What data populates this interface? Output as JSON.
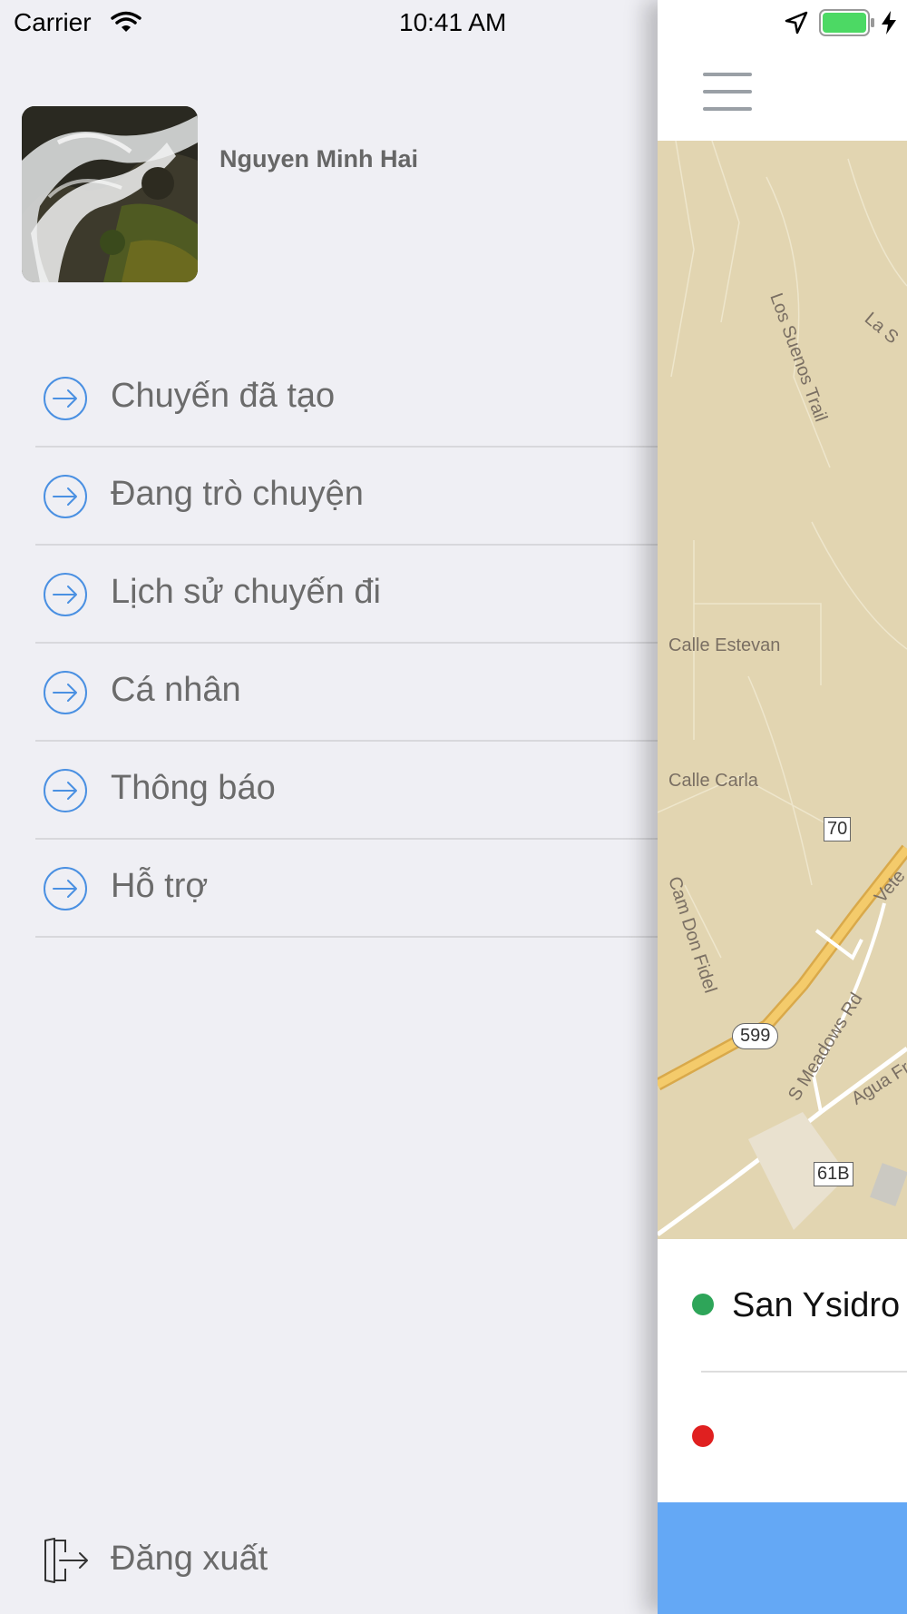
{
  "status_bar": {
    "carrier": "Carrier",
    "time": "10:41 AM"
  },
  "profile": {
    "name": "Nguyen Minh Hai",
    "avatar": "waterfall-photo"
  },
  "menu": {
    "items": [
      {
        "label": "Chuyến đã tạo",
        "icon": "arrow-circle-right-icon"
      },
      {
        "label": "Đang trò chuyện",
        "icon": "arrow-circle-right-icon"
      },
      {
        "label": "Lịch sử chuyến đi",
        "icon": "arrow-circle-right-icon"
      },
      {
        "label": "Cá nhân",
        "icon": "arrow-circle-right-icon"
      },
      {
        "label": "Thông báo",
        "icon": "arrow-circle-right-icon"
      },
      {
        "label": "Hỗ trợ",
        "icon": "arrow-circle-right-icon"
      }
    ],
    "logout_label": "Đăng xuất"
  },
  "map": {
    "labels": {
      "los_suenos": "Los Suenos Trail",
      "la_s": "La S",
      "calle_estevan": "Calle Estevan",
      "calle_carla": "Calle Carla",
      "cam_don_fidel": "Cam Don Fidel",
      "vete": "Vete",
      "s_meadows": "S Meadows Rd",
      "agua_fr": "Agua Fr"
    },
    "shields": {
      "r70": "70",
      "r599": "599",
      "r61b": "61B"
    }
  },
  "route": {
    "origin": "San Ysidro",
    "destination": ""
  },
  "colors": {
    "drawer_bg": "#efeff4",
    "accent_blue": "#64a8f5",
    "origin_dot": "#2ea559",
    "destination_dot": "#e02020",
    "map_land": "#e2d5b1"
  }
}
